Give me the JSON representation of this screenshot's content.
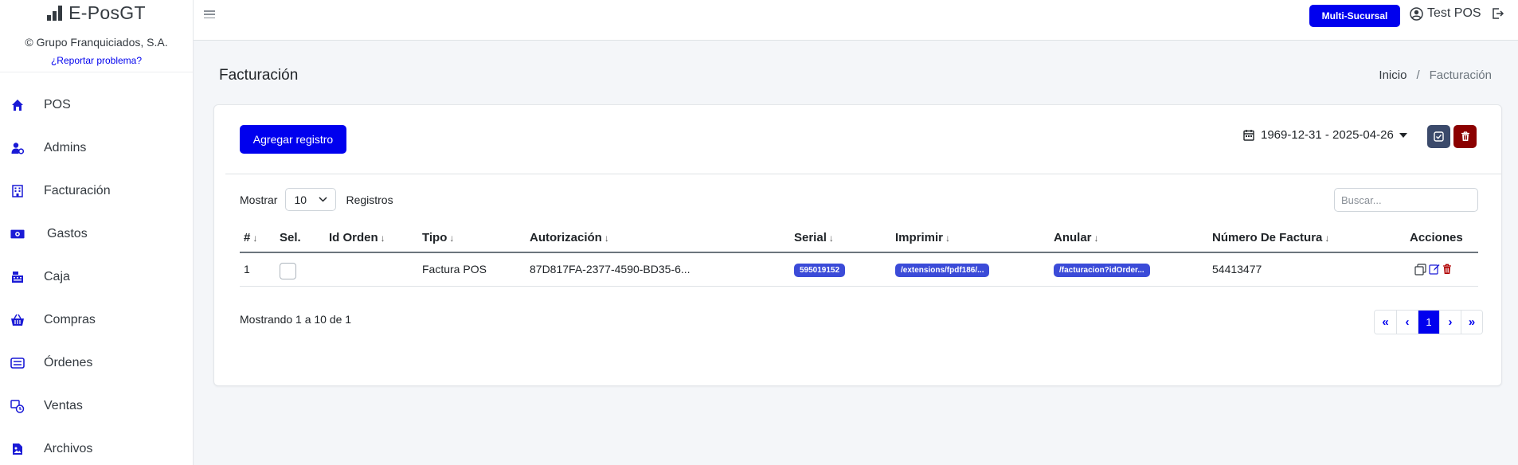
{
  "brand": {
    "title": "E-PosGT",
    "copyright": "© Grupo Franquiciados, S.A.",
    "report_link": "¿Reportar problema?"
  },
  "sidebar": {
    "items": [
      {
        "label": "POS",
        "icon": "home-icon"
      },
      {
        "label": "Admins",
        "icon": "user-gear-icon"
      },
      {
        "label": "Facturación",
        "icon": "building-icon"
      },
      {
        "label": "Gastos",
        "icon": "money-icon"
      },
      {
        "label": "Caja",
        "icon": "cash-register-icon"
      },
      {
        "label": "Compras",
        "icon": "basket-icon"
      },
      {
        "label": "Órdenes",
        "icon": "receipt-icon"
      },
      {
        "label": "Ventas",
        "icon": "sales-icon"
      },
      {
        "label": "Archivos",
        "icon": "file-image-icon"
      }
    ]
  },
  "topbar": {
    "multi_label": "Multi-Sucursal",
    "user_name": "Test POS"
  },
  "header": {
    "title": "Facturación",
    "breadcrumb": {
      "home": "Inicio",
      "separator": "/",
      "current": "Facturación"
    }
  },
  "toolbar": {
    "add_label": "Agregar registro",
    "date_range": "1969-12-31 - 2025-04-26"
  },
  "table_controls": {
    "show_label": "Mostrar",
    "page_size": "10",
    "records_label": "Registros",
    "search_placeholder": "Buscar..."
  },
  "table": {
    "headers": [
      "#",
      "Sel.",
      "Id Orden",
      "Tipo",
      "Autorización",
      "Serial",
      "Imprimir",
      "Anular",
      "Número De Factura",
      "Acciones"
    ],
    "sort_glyph": "↓",
    "rows": [
      {
        "num": "1",
        "id_orden": "",
        "tipo": "Factura POS",
        "autorizacion": "87D817FA-2377-4590-BD35-6...",
        "serial": "595019152",
        "imprimir": "/extensions/fpdf186/...",
        "anular": "/facturacion?idOrder...",
        "numero_factura": "54413477"
      }
    ]
  },
  "footer": {
    "info": "Mostrando 1 a 10 de 1",
    "pages": [
      "«",
      "‹",
      "1",
      "›",
      "»"
    ],
    "active_page": "1"
  },
  "colors": {
    "primary": "#0000ee",
    "badge": "#3b4bd8",
    "dark_btn": "#3b4a6b",
    "danger_btn": "#8b0000",
    "sidebar_icon": "#1a1ad6"
  }
}
